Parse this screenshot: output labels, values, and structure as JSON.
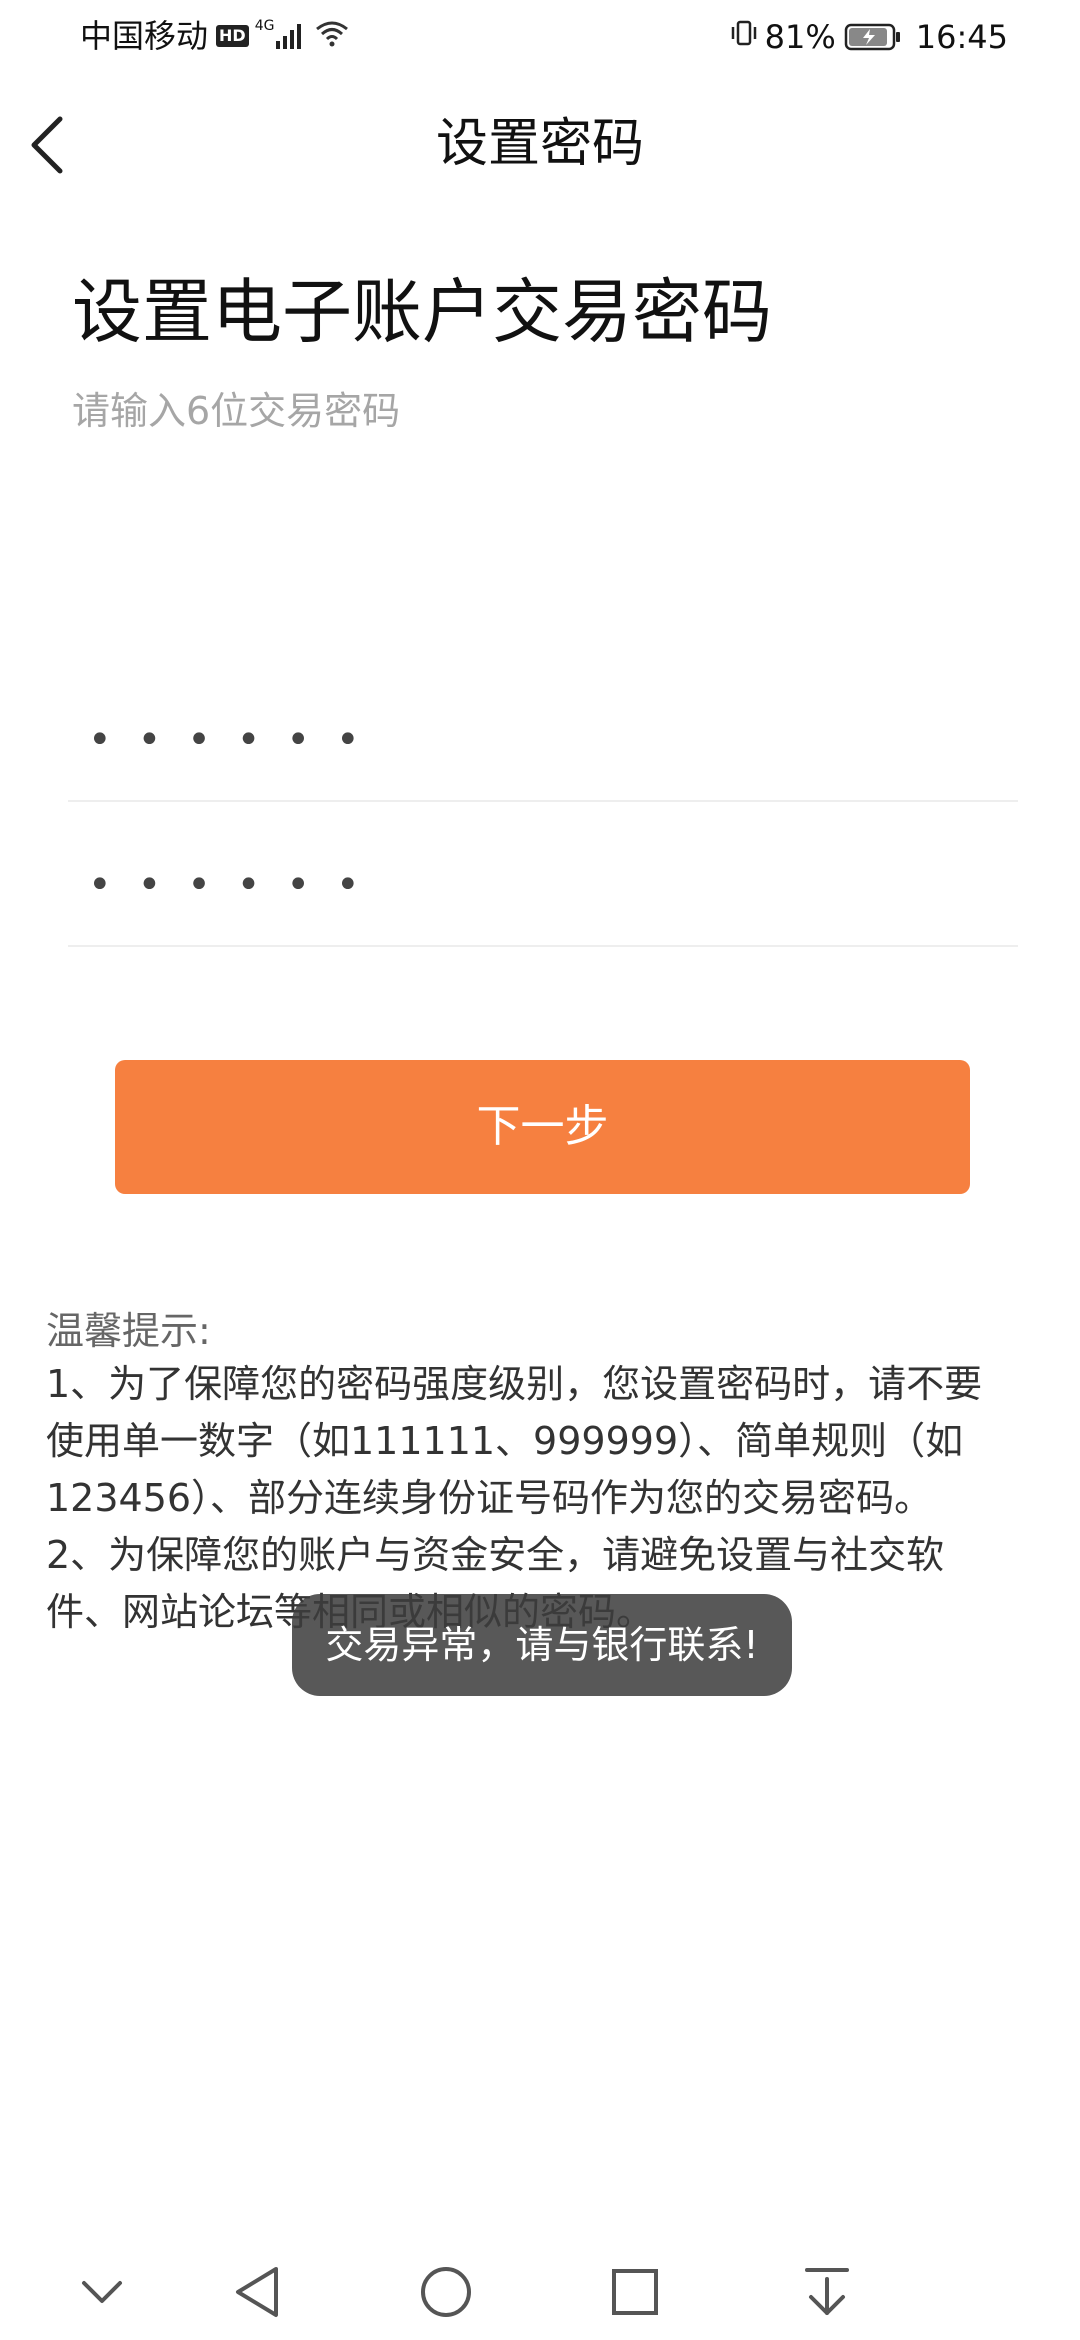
{
  "status_bar": {
    "carrier": "中国移动",
    "hd": "HD",
    "network_type": "4G",
    "battery_percent": "81%",
    "time": "16:45"
  },
  "header": {
    "title": "设置密码",
    "back_icon": "chevron-left-icon"
  },
  "form": {
    "heading": "设置电子账户交易密码",
    "subheading": "请输入6位交易密码",
    "password_value": "••••••",
    "confirm_value": "••••••",
    "next_label": "下一步"
  },
  "tips": {
    "title": "温馨提示:",
    "item1": "1、为了保障您的密码强度级别，您设置密码时，请不要使用单一数字（如111111、999999）、简单规则（如123456）、部分连续身份证号码作为您的交易密码。",
    "item2": "2、为保障您的账户与资金安全，请避免设置与社交软件、网站论坛等相同或相似的密码。"
  },
  "toast": {
    "message": "交易异常，请与银行联系!"
  },
  "colors": {
    "accent": "#f68040",
    "hint": "#a6a6a6"
  },
  "bottom_nav": {
    "icons": [
      "chevron-down-icon",
      "back-triangle-icon",
      "home-circle-icon",
      "recents-square-icon",
      "download-arrow-icon"
    ]
  }
}
